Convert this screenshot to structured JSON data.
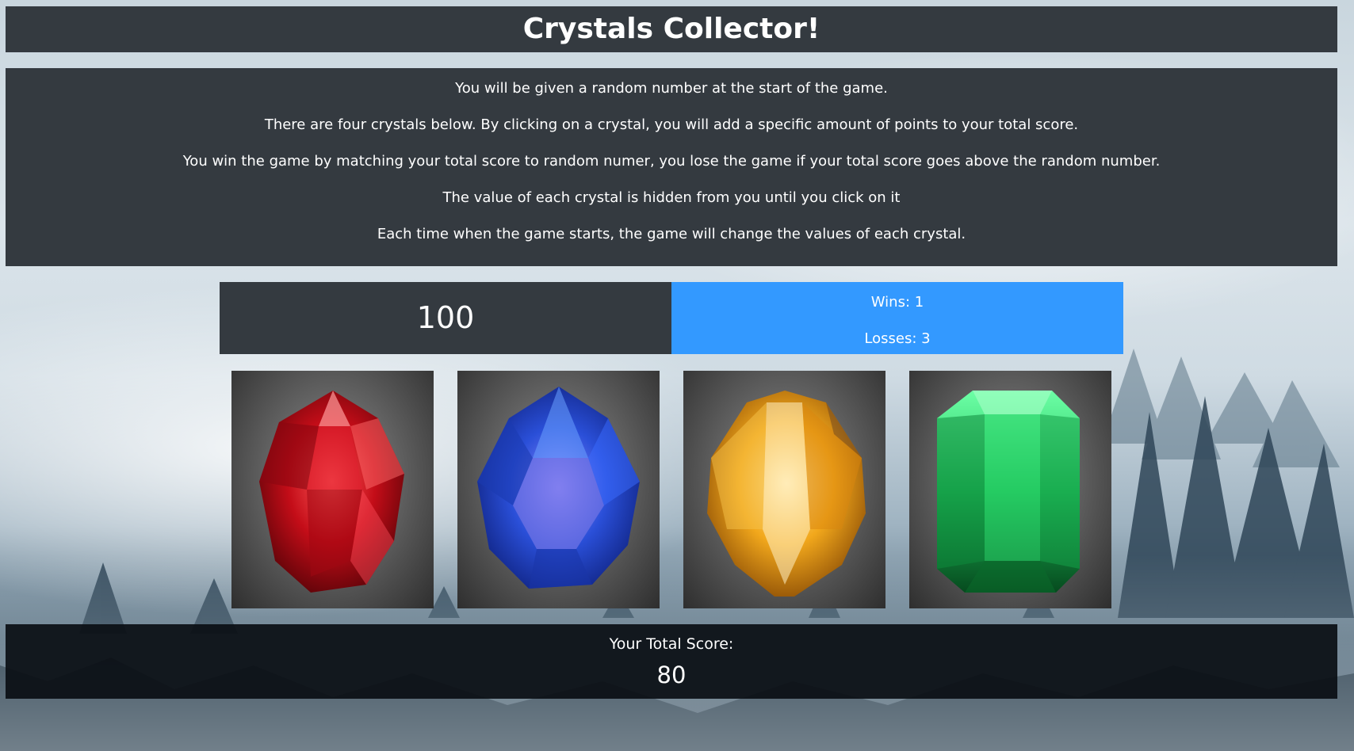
{
  "header": {
    "title": "Crystals Collector!"
  },
  "instructions": [
    "You will be given a random number at the start of the game.",
    "There are four crystals below. By clicking on a crystal, you will add a specific amount of points to your total score.",
    "You win the game by matching your total score to random numer, you lose the game if your total score goes above the random number.",
    "The value of each crystal is hidden from you until you click on it",
    "Each time when the game starts, the game will change the values of each crystal."
  ],
  "target": {
    "number": "100"
  },
  "record": {
    "wins": "Wins: 1",
    "losses": "Losses: 3"
  },
  "crystals": [
    {
      "name": "red crystal",
      "color": "#d4121e",
      "icon": "red-crystal-icon"
    },
    {
      "name": "blue crystal",
      "color": "#2a4fd8",
      "icon": "blue-crystal-icon"
    },
    {
      "name": "yellow crystal",
      "color": "#f2a81c",
      "icon": "yellow-crystal-icon"
    },
    {
      "name": "green crystal",
      "color": "#1fbf5a",
      "icon": "green-crystal-icon"
    }
  ],
  "score": {
    "label": "Your Total Score:",
    "value": "80"
  },
  "colors": {
    "panel": "#343a40",
    "accent": "#3399ff"
  }
}
